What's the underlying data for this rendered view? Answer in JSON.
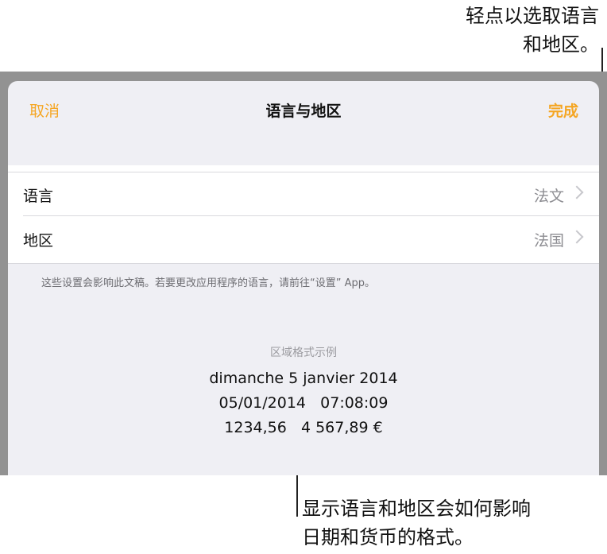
{
  "callouts": {
    "top": {
      "line1": "轻点以选取语言",
      "line2": "和地区。"
    },
    "bottom": {
      "line1": "显示语言和地区会如何影响",
      "line2": "日期和货币的格式。"
    }
  },
  "navbar": {
    "cancel_label": "取消",
    "title": "语言与地区",
    "done_label": "完成"
  },
  "settings": {
    "rows": [
      {
        "label": "语言",
        "value": "法文"
      },
      {
        "label": "地区",
        "value": "法国"
      }
    ],
    "note": "这些设置会影响此文稿。若要更改应用程序的语言，请前往“设置” App。"
  },
  "region_sample": {
    "title": "区域格式示例",
    "date": "dimanche 5 janvier 2014",
    "datetime": "05/01/2014   07:08:09",
    "numbers": "1234,56   4 567,89 €"
  },
  "colors": {
    "accent": "#f5a623",
    "dim_background": "#929292",
    "sheet_background": "#efeff4"
  }
}
